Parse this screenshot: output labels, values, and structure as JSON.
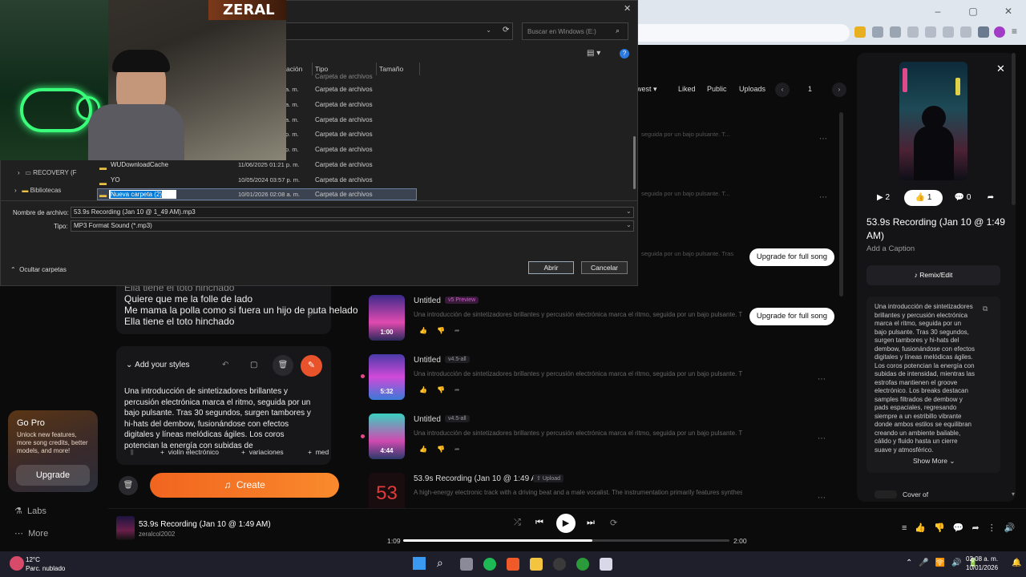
{
  "colors": {
    "accent": "#f56a22",
    "dialog_bg": "#202020",
    "app_bg": "#0b0b0c",
    "selection": "#0078d4"
  },
  "dialog": {
    "search_placeholder": "Buscar en Windows (E:)",
    "columns": {
      "modified": "ación",
      "type": "Tipo",
      "size": "Tamaño"
    },
    "rows": [
      {
        "date": "a. m.",
        "type": "Carpeta de archivos"
      },
      {
        "date": "a. m.",
        "type": "Carpeta de archivos"
      },
      {
        "date": "a. m.",
        "type": "Carpeta de archivos"
      },
      {
        "date": "p. m.",
        "type": "Carpeta de archivos"
      },
      {
        "date": "p. m.",
        "type": "Carpeta de archivos"
      }
    ],
    "files": [
      {
        "name": "WUDownloadCache",
        "date": "11/06/2025 01:21 p. m.",
        "type": "Carpeta de archivos"
      },
      {
        "name": "YO",
        "date": "10/05/2024 03:57 p. m.",
        "type": "Carpeta de archivos"
      }
    ],
    "selected": {
      "name": "Nueva carpeta (2)",
      "date": "10/01/2026 02:08 a. m.",
      "type": "Carpeta de archivos"
    },
    "tree": {
      "recovery": "RECOVERY (F",
      "libraries": "Bibliotecas"
    },
    "filename_label": "Nombre de archivo:",
    "filename_value": "53.9s Recording (Jan 10 @ 1_49 AM).mp3",
    "type_label": "Tipo:",
    "type_value": "MP3 Format Sound (*.mp3)",
    "hide_folders": "Ocultar carpetas",
    "open": "Abrir",
    "cancel": "Cancelar"
  },
  "webcam": {
    "overlay_text": "ZERAL"
  },
  "sidebar": {
    "gopro": {
      "title": "Go Pro",
      "desc": "Unlock new features, more song credits, better models, and more!",
      "button": "Upgrade"
    },
    "labs": "Labs",
    "more": "More"
  },
  "create": {
    "lyrics": [
      "Ella tiene el toto hinchado",
      "Quiere que me la folle de lado",
      "Me mama la polla como si fuera un hijo de puta helado",
      "Ella tiene el toto hinchado"
    ],
    "styles_heading": "Add your styles",
    "styles_text": "Una introducción de sintetizadores brillantes y percusión electrónica marca el ritmo, seguida por un bajo pulsante. Tras 30 segundos, surgen tambores y hi-hats del dembow, fusionándose con efectos digitales y líneas melódicas ágiles. Los coros potencian la energía con subidas de",
    "chips": [
      "violín electrónico",
      "variaciones",
      "med"
    ],
    "create_button": "Create"
  },
  "filters": {
    "newest": "west",
    "liked": "Liked",
    "public": "Public",
    "uploads": "Uploads",
    "page": "1"
  },
  "tracks": [
    {
      "title": "Untitled",
      "badge": "v5 Preview",
      "duration": "1:00",
      "desc": "Una introducción de sintetizadores brillantes y percusión electrónica marca el ritmo, seguida por un bajo pulsante. Tras",
      "upgrade": "Upgrade for full song"
    },
    {
      "title": "Untitled",
      "badge": "v4.5-all",
      "duration": "5:32",
      "desc": "Una introducción de sintetizadores brillantes y percusión electrónica marca el ritmo, seguida por un bajo pulsante. T..."
    },
    {
      "title": "Untitled",
      "badge": "v4.5-all",
      "duration": "4:44",
      "desc": "Una introducción de sintetizadores brillantes y percusión electrónica marca el ritmo, seguida por un bajo pulsante. T..."
    },
    {
      "title": "53.9s Recording (Jan 10 @ 1:49 AM)",
      "badge": "Upload",
      "duration": "",
      "desc": "A high-energy electronic track with a driving beat and a male vocalist. The instrumentation primarily features synthes..."
    }
  ],
  "hidden_rows": [
    {
      "desc": "seguida por un bajo pulsante. T..."
    },
    {
      "desc": "seguida por un bajo pulsante. T..."
    },
    {
      "desc": "seguida por un bajo pulsante. Tras",
      "upgrade": "Upgrade for full song"
    }
  ],
  "right_panel": {
    "plays": "2",
    "likes": "1",
    "comments": "0",
    "title": "53.9s Recording (Jan 10 @ 1:49 AM)",
    "caption": "Add a Caption",
    "remix": "Remix/Edit",
    "description": "Una introducción de sintetizadores brillantes y percusión electrónica marca el ritmo, seguida por un bajo pulsante. Tras 30 segundos, surgen tambores y hi-hats del dembow, fusionándose con efectos digitales y líneas melódicas ágiles. Los coros potencian la energía con subidas de intensidad, mientras las estrofas mantienen el groove electrónico. Los breaks destacan samples filtrados de dembow y pads espaciales, regresando siempre a un estribillo vibrante donde ambos estilos se equilibran creando un ambiente bailable, cálido y fluido hasta un cierre suave y atmosférico.",
    "show_more": "Show More",
    "cover_of": "Cover of"
  },
  "player": {
    "title": "53.9s Recording (Jan 10 @ 1:49 AM)",
    "user": "zeralcol2002",
    "current": "1:09",
    "total": "2:00",
    "progress": 0.58
  },
  "taskbar": {
    "temp": "12°C",
    "weather": "Parc. nublado",
    "time": "02:08 a. m.",
    "date": "10/01/2026"
  }
}
